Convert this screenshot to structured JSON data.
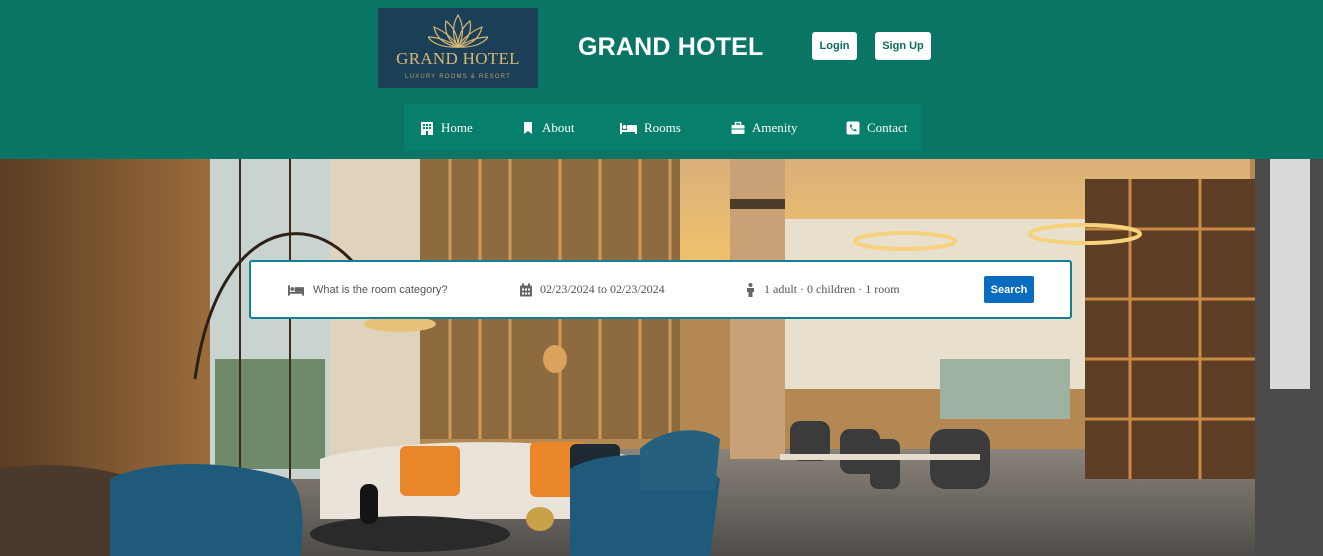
{
  "logo": {
    "name": "GRAND HOTEL",
    "tagline": "LUXURY ROOMS & RESORT",
    "icon": "lotus-icon",
    "bg_color": "#1c3f58",
    "gold_color": "#d6b874"
  },
  "header": {
    "title": "GRAND HOTEL",
    "bg_color": "#0a7565",
    "login_label": "Login",
    "signup_label": "Sign Up"
  },
  "nav": {
    "items": [
      {
        "label": "Home",
        "icon": "building-icon"
      },
      {
        "label": "About",
        "icon": "bookmark-icon"
      },
      {
        "label": "Rooms",
        "icon": "bed-icon"
      },
      {
        "label": "Amenity",
        "icon": "briefcase-icon"
      },
      {
        "label": "Contact",
        "icon": "phone-icon"
      }
    ]
  },
  "search": {
    "category_placeholder": "What is the room category?",
    "category_icon": "bed-icon",
    "dates": "02/23/2024 to 02/23/2024",
    "dates_icon": "calendar-icon",
    "guests": "1 adult · 0 children · 1 room",
    "guests_icon": "person-icon",
    "button_label": "Search",
    "accent_color": "#0a6cbe"
  },
  "hero": {
    "image": "hotel-lobby-photo"
  }
}
